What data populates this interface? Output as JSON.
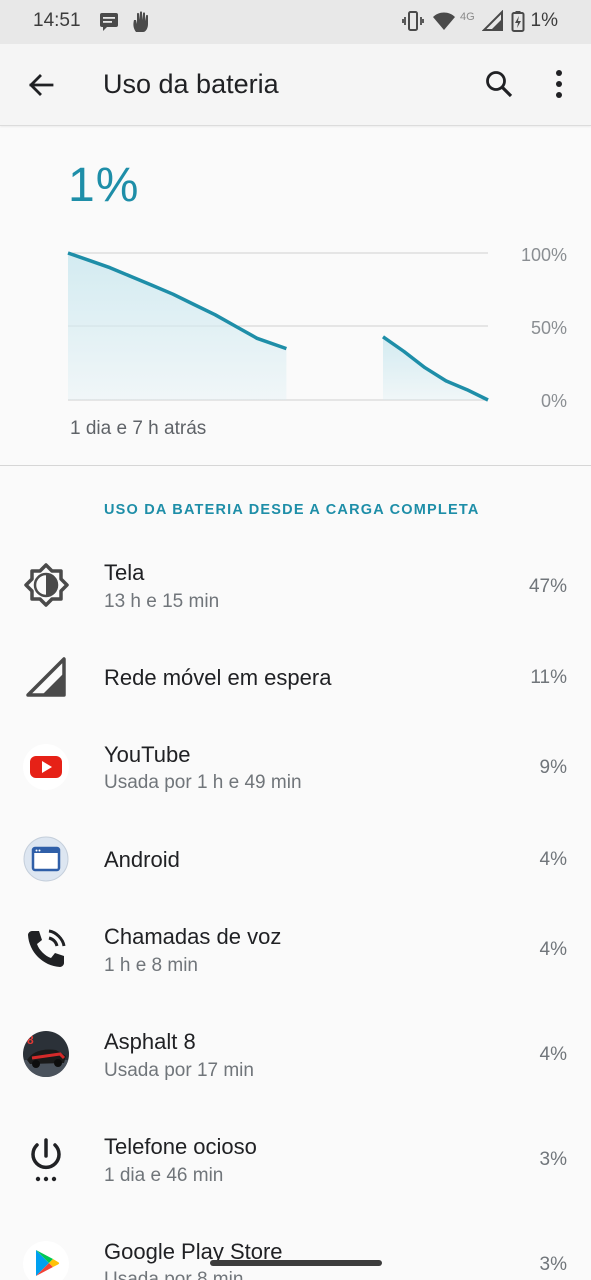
{
  "status_bar": {
    "time": "14:51",
    "network_type": "4G",
    "battery_percent": "1%",
    "icons": [
      "message-icon",
      "hand-icon",
      "vibrate-icon",
      "wifi-icon",
      "cell-signal-icon",
      "battery-icon"
    ]
  },
  "app_bar": {
    "title": "Uso da bateria",
    "back_icon": "arrow-back-icon",
    "search_icon": "search-icon",
    "more_icon": "more-vert-icon"
  },
  "battery": {
    "level": "1%",
    "time_ago": "1 dia e 7 h atrás"
  },
  "chart_data": {
    "type": "area",
    "ylabels": [
      "100%",
      "50%",
      "0%"
    ],
    "ylim": [
      0,
      100
    ],
    "grid": true,
    "segments": [
      {
        "x": [
          0,
          5,
          10,
          15,
          20,
          25,
          30,
          35,
          40,
          45,
          52
        ],
        "y": [
          100,
          95,
          90,
          84,
          78,
          72,
          65,
          58,
          50,
          42,
          35
        ]
      },
      {
        "x": [
          75,
          80,
          85,
          90,
          95,
          100
        ],
        "y": [
          43,
          33,
          22,
          13,
          7,
          0
        ]
      }
    ],
    "accent": "#1e8ea8",
    "fill": "#d3ebf1"
  },
  "usage": {
    "header": "USO DA BATERIA DESDE A CARGA COMPLETA",
    "items": [
      {
        "title": "Tela",
        "subtitle": "13 h e 15 min",
        "percent": "47%",
        "icon": "brightness-icon"
      },
      {
        "title": "Rede móvel em espera",
        "subtitle": "",
        "percent": "11%",
        "icon": "cell-signal-icon"
      },
      {
        "title": "YouTube",
        "subtitle": "Usada por 1 h e 49 min",
        "percent": "9%",
        "icon": "youtube-icon"
      },
      {
        "title": "Android",
        "subtitle": "",
        "percent": "4%",
        "icon": "android-system-icon"
      },
      {
        "title": "Chamadas de voz",
        "subtitle": "1 h e 8 min",
        "percent": "4%",
        "icon": "phone-call-icon"
      },
      {
        "title": "Asphalt 8",
        "subtitle": "Usada por 17 min",
        "percent": "4%",
        "icon": "asphalt-8-icon"
      },
      {
        "title": "Telefone ocioso",
        "subtitle": "1 dia e 46 min",
        "percent": "3%",
        "icon": "power-icon"
      },
      {
        "title": "Google Play Store",
        "subtitle": "Usada por 8 min",
        "percent": "3%",
        "icon": "play-store-icon"
      }
    ]
  }
}
